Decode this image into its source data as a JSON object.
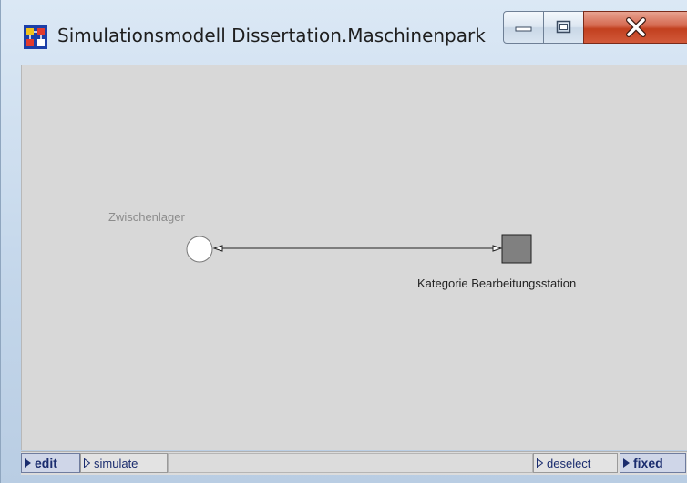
{
  "window": {
    "title": "Simulationsmodell Dissertation.Maschinenpark",
    "controls": [
      "minimize",
      "maximize",
      "close"
    ]
  },
  "diagram": {
    "nodes": [
      {
        "label": "Zwischenlager",
        "shape": "circle",
        "label_color": "#8c8c8c"
      },
      {
        "label": "Kategorie Bearbeitungsstation",
        "shape": "square",
        "fill": "#808080"
      }
    ],
    "edge": {
      "from": "Zwischenlager",
      "to": "Kategorie Bearbeitungsstation"
    }
  },
  "statusbar": {
    "edit": "edit",
    "simulate": "simulate",
    "deselect": "deselect",
    "fixed": "fixed"
  },
  "icons": {
    "app": "app-model-icon",
    "minimize": "minimize-icon",
    "maximize": "maximize-icon",
    "close": "close-icon"
  },
  "colors": {
    "canvas": "#d8d8d8",
    "close_button": "#c2401f",
    "active_mode": "#1a2c6e"
  }
}
